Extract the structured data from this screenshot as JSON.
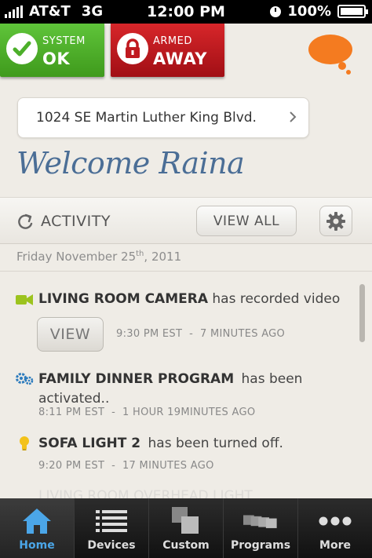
{
  "status_bar": {
    "carrier": "AT&T",
    "network": "3G",
    "time": "12:00 PM",
    "battery": "100%",
    "battery_level": 1.0
  },
  "system_tile": {
    "line1": "SYSTEM",
    "line2": "OK",
    "color": "#4caf2a"
  },
  "armed_tile": {
    "line1": "ARMED",
    "line2": "AWAY",
    "color": "#c0191f"
  },
  "brand": {
    "logo_icon": "speech-bubble-logo-icon",
    "color": "#f47b20"
  },
  "address": {
    "text": "1024 SE Martin Luther King Blvd."
  },
  "welcome": {
    "text": "Welcome Raina"
  },
  "activity": {
    "title": "ACTIVITY",
    "view_all": "VIEW ALL",
    "date": {
      "weekday": "Friday",
      "month_day": "November 25",
      "suffix": "th",
      "year": ", 2011"
    }
  },
  "feed": [
    {
      "icon": "camera-icon",
      "name": "LIVING ROOM CAMERA",
      "text": " has recorded video",
      "button": "VIEW",
      "time": "9:30 PM  EST",
      "sep": "-",
      "ago": "7 MINUTES AGO"
    },
    {
      "icon": "gears-icon",
      "name": "FAMILY DINNER PROGRAM",
      "text": " has been",
      "text2": "activated..",
      "time": "8:11 PM  EST",
      "sep": "-",
      "ago": "1 HOUR 19MINUTES AGO"
    },
    {
      "icon": "lightbulb-icon",
      "name": "SOFA LIGHT 2",
      "text": " has been turned off.",
      "time": "9:20 PM  EST",
      "sep": "-",
      "ago": "17 MINUTES AGO"
    },
    {
      "name": "LIVING ROOM OVERHEAD LIGHT"
    }
  ],
  "tabs": [
    {
      "label": "Home",
      "icon": "home-icon",
      "active": true
    },
    {
      "label": "Devices",
      "icon": "list-icon"
    },
    {
      "label": "Custom",
      "icon": "custom-squares-icon"
    },
    {
      "label": "Programs",
      "icon": "programs-stack-icon"
    },
    {
      "label": "More",
      "icon": "more-dots-icon"
    }
  ],
  "colors": {
    "accent_blue": "#4b6e96",
    "tab_active": "#4ba6e8"
  }
}
